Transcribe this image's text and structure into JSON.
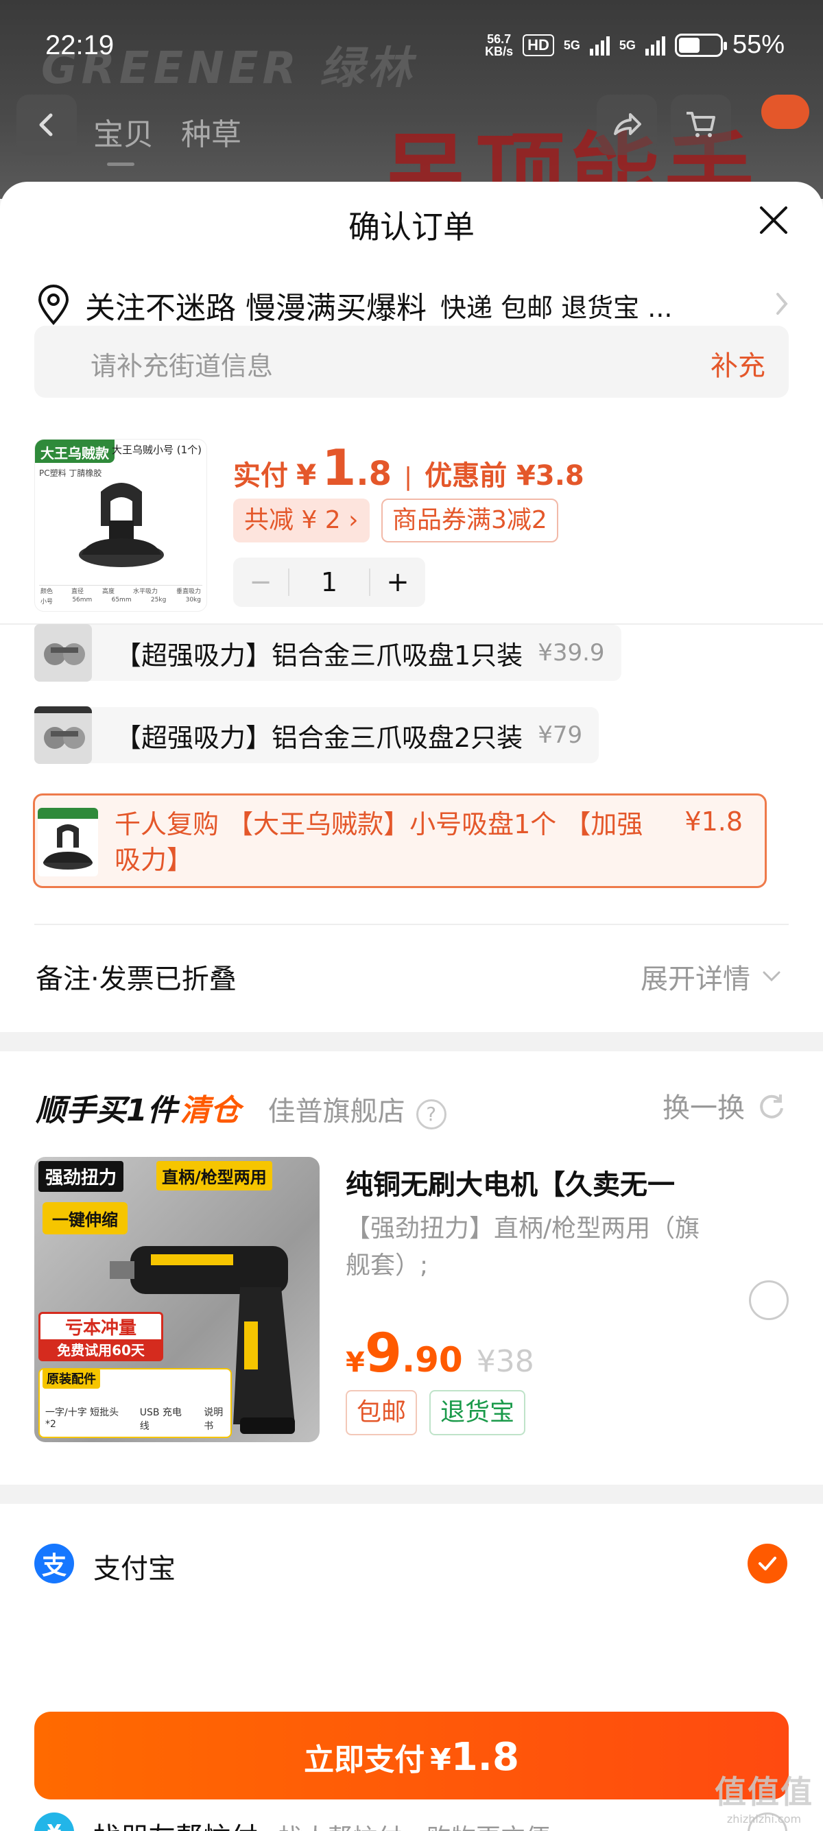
{
  "status_bar": {
    "time": "22:19",
    "net_speed_value": "56.7",
    "net_speed_unit": "KB/s",
    "hd_label": "HD",
    "sim1_label": "5G",
    "sim2_label": "5G",
    "battery": "55%"
  },
  "background": {
    "brand_text": "GREENER 绿林",
    "banner_text": "吊顶能手"
  },
  "top_nav": {
    "tabs": [
      "宝贝",
      "种草"
    ]
  },
  "sheet": {
    "title": "确认订单"
  },
  "address": {
    "main": "关注不迷路 慢漫满买爆料",
    "sub": "快递 包邮 退货宝 ...",
    "street_placeholder": "请补充街道信息",
    "street_action": "补充"
  },
  "product": {
    "tag_main": "大王乌贼款",
    "tag_sub": "大王乌贼小号 (1个)",
    "tag_material": "PC塑料 丁腈橡胶",
    "table_headers": [
      "颜色",
      "直径",
      "高度",
      "水平吸力",
      "垂直吸力"
    ],
    "table_values": [
      "小号",
      "56mm",
      "65mm",
      "25kg",
      "30kg"
    ],
    "price_label": "实付",
    "price_yen": "¥",
    "price_int": "1",
    "price_dec": ".8",
    "orig_label": "优惠前 ¥3.8",
    "discount": "共减 ¥ 2 ›",
    "coupon": "商品券满3减2",
    "qty_minus": "−",
    "qty": "1",
    "qty_plus": "+"
  },
  "options": [
    {
      "label": "【超强吸力】铝合金三爪吸盘1只装",
      "price": "¥39.9"
    },
    {
      "label": "【超强吸力】铝合金三爪吸盘2只装",
      "price": "¥79"
    }
  ],
  "selected_option": {
    "label": "千人复购 【大王乌贼款】小号吸盘1个 【加强吸力】",
    "price": "¥1.8"
  },
  "remark": {
    "label": "备注·发票已折叠",
    "expand": "展开详情"
  },
  "addon": {
    "title_a": "顺手买1件",
    "title_b": "清仓",
    "store": "佳普旗舰店",
    "help": "?",
    "swap": "换一换",
    "img_tag1": "强劲扭力",
    "img_tag2": "直柄/枪型两用",
    "img_tag3": "一键伸缩",
    "img_badge_a": "亏本冲量",
    "img_badge_b": "免费试用60天",
    "img_acc_title": "原装配件",
    "img_acc_items": [
      "一字/十字 短批头*2",
      "USB 充电线",
      "说明书"
    ],
    "name": "纯铜无刷大电机【久卖无一",
    "spec": "【强劲扭力】直柄/枪型两用（旗舰套）;",
    "price_yen": "¥",
    "price_int": "9",
    "price_dec": ".90",
    "orig_price": "¥38",
    "tag_shipping": "包邮",
    "tag_return": "退货宝"
  },
  "payment": {
    "methods": [
      {
        "icon": "支",
        "label": "支付宝",
        "desc": "",
        "selected": true
      },
      {
        "icon": "¥",
        "label": "找朋友帮忙付",
        "desc": "找人帮忙付，购物更方便",
        "selected": false
      }
    ],
    "button_label": "立即支付",
    "button_yen": "¥",
    "button_amount": "1.8"
  },
  "watermark": {
    "main": "值值值",
    "sub": "zhizhizhi.com"
  },
  "colors": {
    "accent": "#ff5a00",
    "accent_soft": "#e4572a",
    "green": "#1a9a4a",
    "alipay_blue": "#1677ff"
  }
}
